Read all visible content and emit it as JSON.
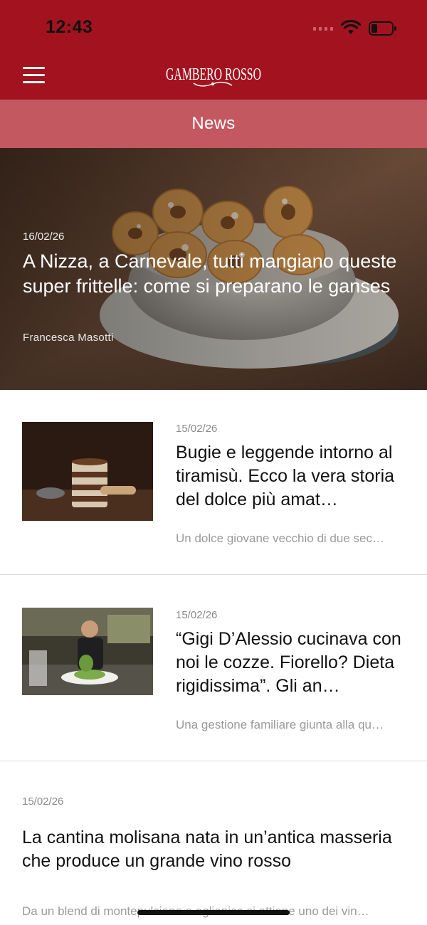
{
  "status_bar": {
    "time": "12:43"
  },
  "header": {
    "logo_text": "GAMBERO ROSSO",
    "section_title": "News"
  },
  "hero": {
    "date": "16/02/26",
    "title": "A Nizza, a Carnevale, tutti mangiano queste super frittelle: come si preparano le ganses",
    "author": "Francesca Masotti"
  },
  "articles": [
    {
      "date": "15/02/26",
      "title": "Bugie e leggende intorno al tiramisù. Ecco la vera storia del dolce più amat…",
      "excerpt": "Un dolce giovane vecchio di due sec…"
    },
    {
      "date": "15/02/26",
      "title": "“Gigi D’Alessio cucinava con noi le cozze. Fiorello? Dieta rigidissima”. Gli an…",
      "excerpt": "Una gestione familiare giunta alla qu…"
    },
    {
      "date": "15/02/26",
      "title": "La cantina molisana nata in un’antica masseria che produce un grande vino rosso",
      "excerpt": "Da un blend di montepulciano e aglianico si ottiene uno dei vin…"
    }
  ],
  "colors": {
    "brand_red": "#a3131f",
    "section_bar": "#c45861"
  }
}
